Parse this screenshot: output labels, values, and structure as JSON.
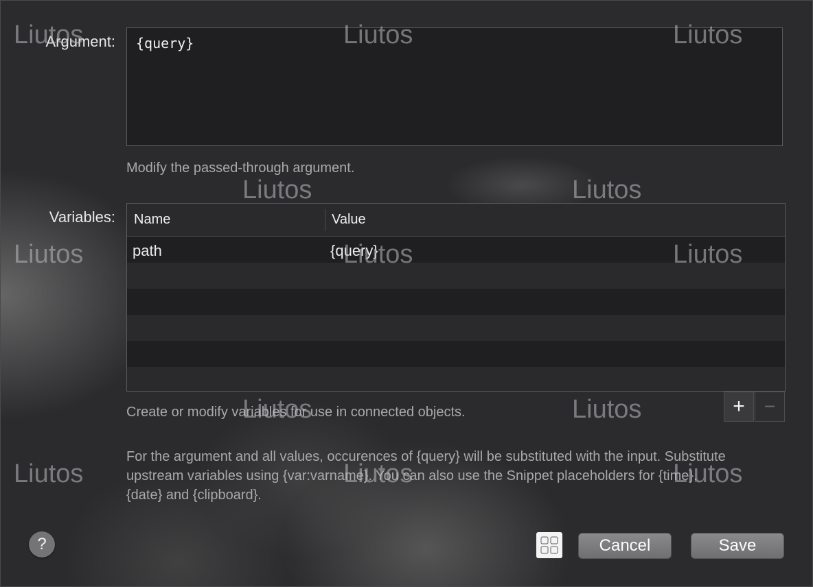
{
  "argument": {
    "label": "Argument:",
    "value": "{query}",
    "help": "Modify the passed-through argument."
  },
  "variables": {
    "label": "Variables:",
    "columns": [
      "Name",
      "Value"
    ],
    "rows": [
      {
        "name": "path",
        "value": "{query}"
      },
      {
        "name": "",
        "value": ""
      },
      {
        "name": "",
        "value": ""
      },
      {
        "name": "",
        "value": ""
      },
      {
        "name": "",
        "value": ""
      },
      {
        "name": "",
        "value": ""
      }
    ],
    "help": "Create or modify variables for use in connected objects.",
    "add_symbol": "+",
    "remove_symbol": "−"
  },
  "footnote": "For the argument and all values, occurences of {query} will be substituted with the input. Substitute upstream variables using {var:varname}. You can also use the Snippet placeholders for {time}, {date} and {clipboard}.",
  "footer": {
    "help_symbol": "?",
    "grid_icon": "grid-icon",
    "cancel_label": "Cancel",
    "save_label": "Save"
  },
  "watermark": "Liutos"
}
